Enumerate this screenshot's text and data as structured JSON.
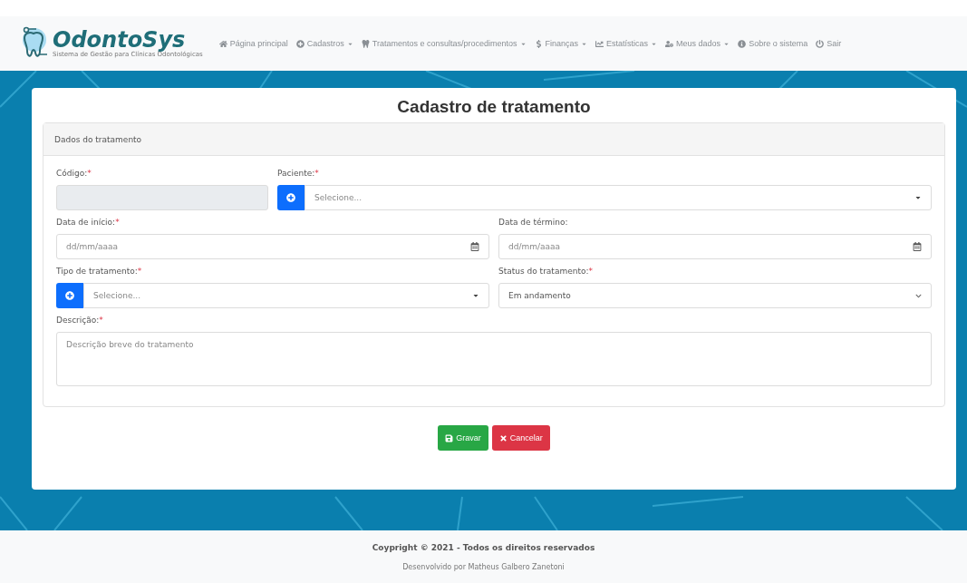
{
  "brand": {
    "name": "OdontoSys",
    "tagline": "Sistema de Gestão para Clínicas Odontológicas"
  },
  "nav": [
    {
      "kind": "home",
      "label": "Página principal",
      "dropdown": false
    },
    {
      "kind": "register",
      "label": "Cadastros",
      "dropdown": true
    },
    {
      "kind": "treatments",
      "label": "Tratamentos e consultas/procedimentos",
      "dropdown": true
    },
    {
      "kind": "finance",
      "label": "Finanças",
      "dropdown": true
    },
    {
      "kind": "stats",
      "label": "Estatísticas",
      "dropdown": true
    },
    {
      "kind": "profile",
      "label": "Meus dados",
      "dropdown": true
    },
    {
      "kind": "about",
      "label": "Sobre o sistema",
      "dropdown": false
    },
    {
      "kind": "logout",
      "label": "Sair",
      "dropdown": false
    }
  ],
  "form": {
    "title": "Cadastro de tratamento",
    "section": "Dados do tratamento",
    "fields": [
      {
        "kind": "readonly",
        "label": "Código:",
        "required": "*"
      },
      {
        "kind": "addon-select",
        "label": "Paciente:",
        "required": "*",
        "placeholder": "Selecione..."
      },
      {
        "kind": "date",
        "label": "Data de início:",
        "required": "*",
        "placeholder": "dd/mm/aaaa"
      },
      {
        "kind": "date",
        "label": "Data de término:",
        "placeholder": "dd/mm/aaaa"
      },
      {
        "kind": "addon-select",
        "label": "Tipo de tratamento:",
        "required": "*",
        "placeholder": "Selecione..."
      },
      {
        "kind": "select",
        "label": "Status do tratamento:",
        "required": "*",
        "value": "Em andamento"
      },
      {
        "kind": "textarea",
        "label": "Descrição:",
        "required": "*",
        "placeholder": "Descrição breve do tratamento"
      }
    ],
    "buttons": [
      {
        "kind": "save",
        "label": "Gravar"
      },
      {
        "kind": "cancel",
        "label": "Cancelar"
      }
    ]
  },
  "footer": {
    "copyright": "Coypright © 2021 - Todos os direitos reservados",
    "credit": "Desenvolvido por Matheus Galbero Zanetoni"
  }
}
